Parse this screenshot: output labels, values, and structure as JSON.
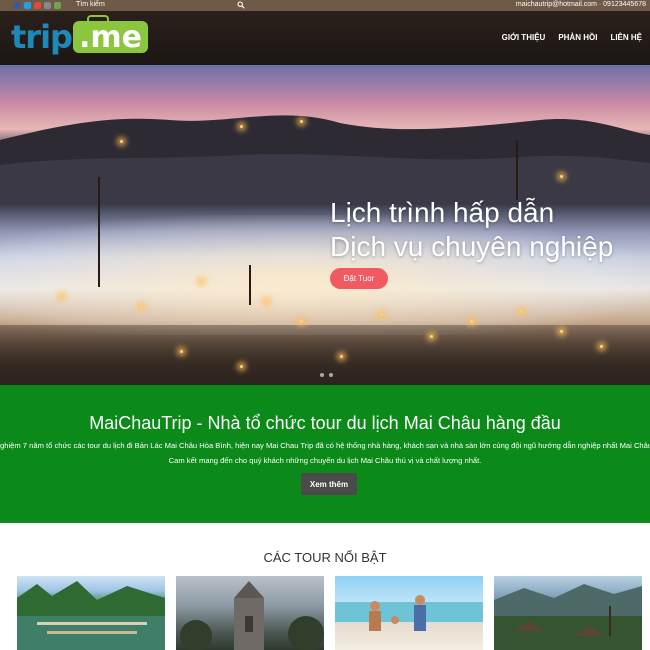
{
  "topbar": {
    "search_label": "Tìm kiếm",
    "contact": "maichautrip@hotmail.com · 09123445678",
    "social_icons": [
      "facebook-icon",
      "twitter-icon",
      "googleplus-icon",
      "flickr-icon",
      "email-icon"
    ]
  },
  "header": {
    "logo_part1": "trip",
    "logo_part2": ".me",
    "nav": [
      "GIỚI THIỆU",
      "PHẢN HỒI",
      "LIÊN HỆ"
    ]
  },
  "hero": {
    "title_line1": "Lịch trình hấp dẫn",
    "title_line2": "Dịch vụ chuyên nghiệp",
    "cta": "Đặt Tuor"
  },
  "intro": {
    "heading": "MaiChauTrip - Nhà tổ chức tour du lịch Mai Châu hàng đầu",
    "text": "nghiệm 7 năm tổ chức các tour du lịch đi Bản Lác Mai Châu Hòa Bình, hiện nay Mai Chau Trip đã có hệ thống nhà hàng, khách sạn và nhà sàn lớn cùng đội ngũ hướng dẫn nghiệp nhất Mai Châu. Cam kết mang đến cho quý khách những chuyến du lịch Mai Châu thú vị và chất lượng nhất.",
    "button": "Xem thêm"
  },
  "tours": {
    "title": "CÁC TOUR NỔI BẬT"
  },
  "colors": {
    "topbar": "#6e5a47",
    "header": "#2a201b",
    "accent_red": "#f05a60",
    "intro_green": "#0b8a1a",
    "logo_blue": "#1e88b8",
    "logo_green": "#8cc63f"
  }
}
